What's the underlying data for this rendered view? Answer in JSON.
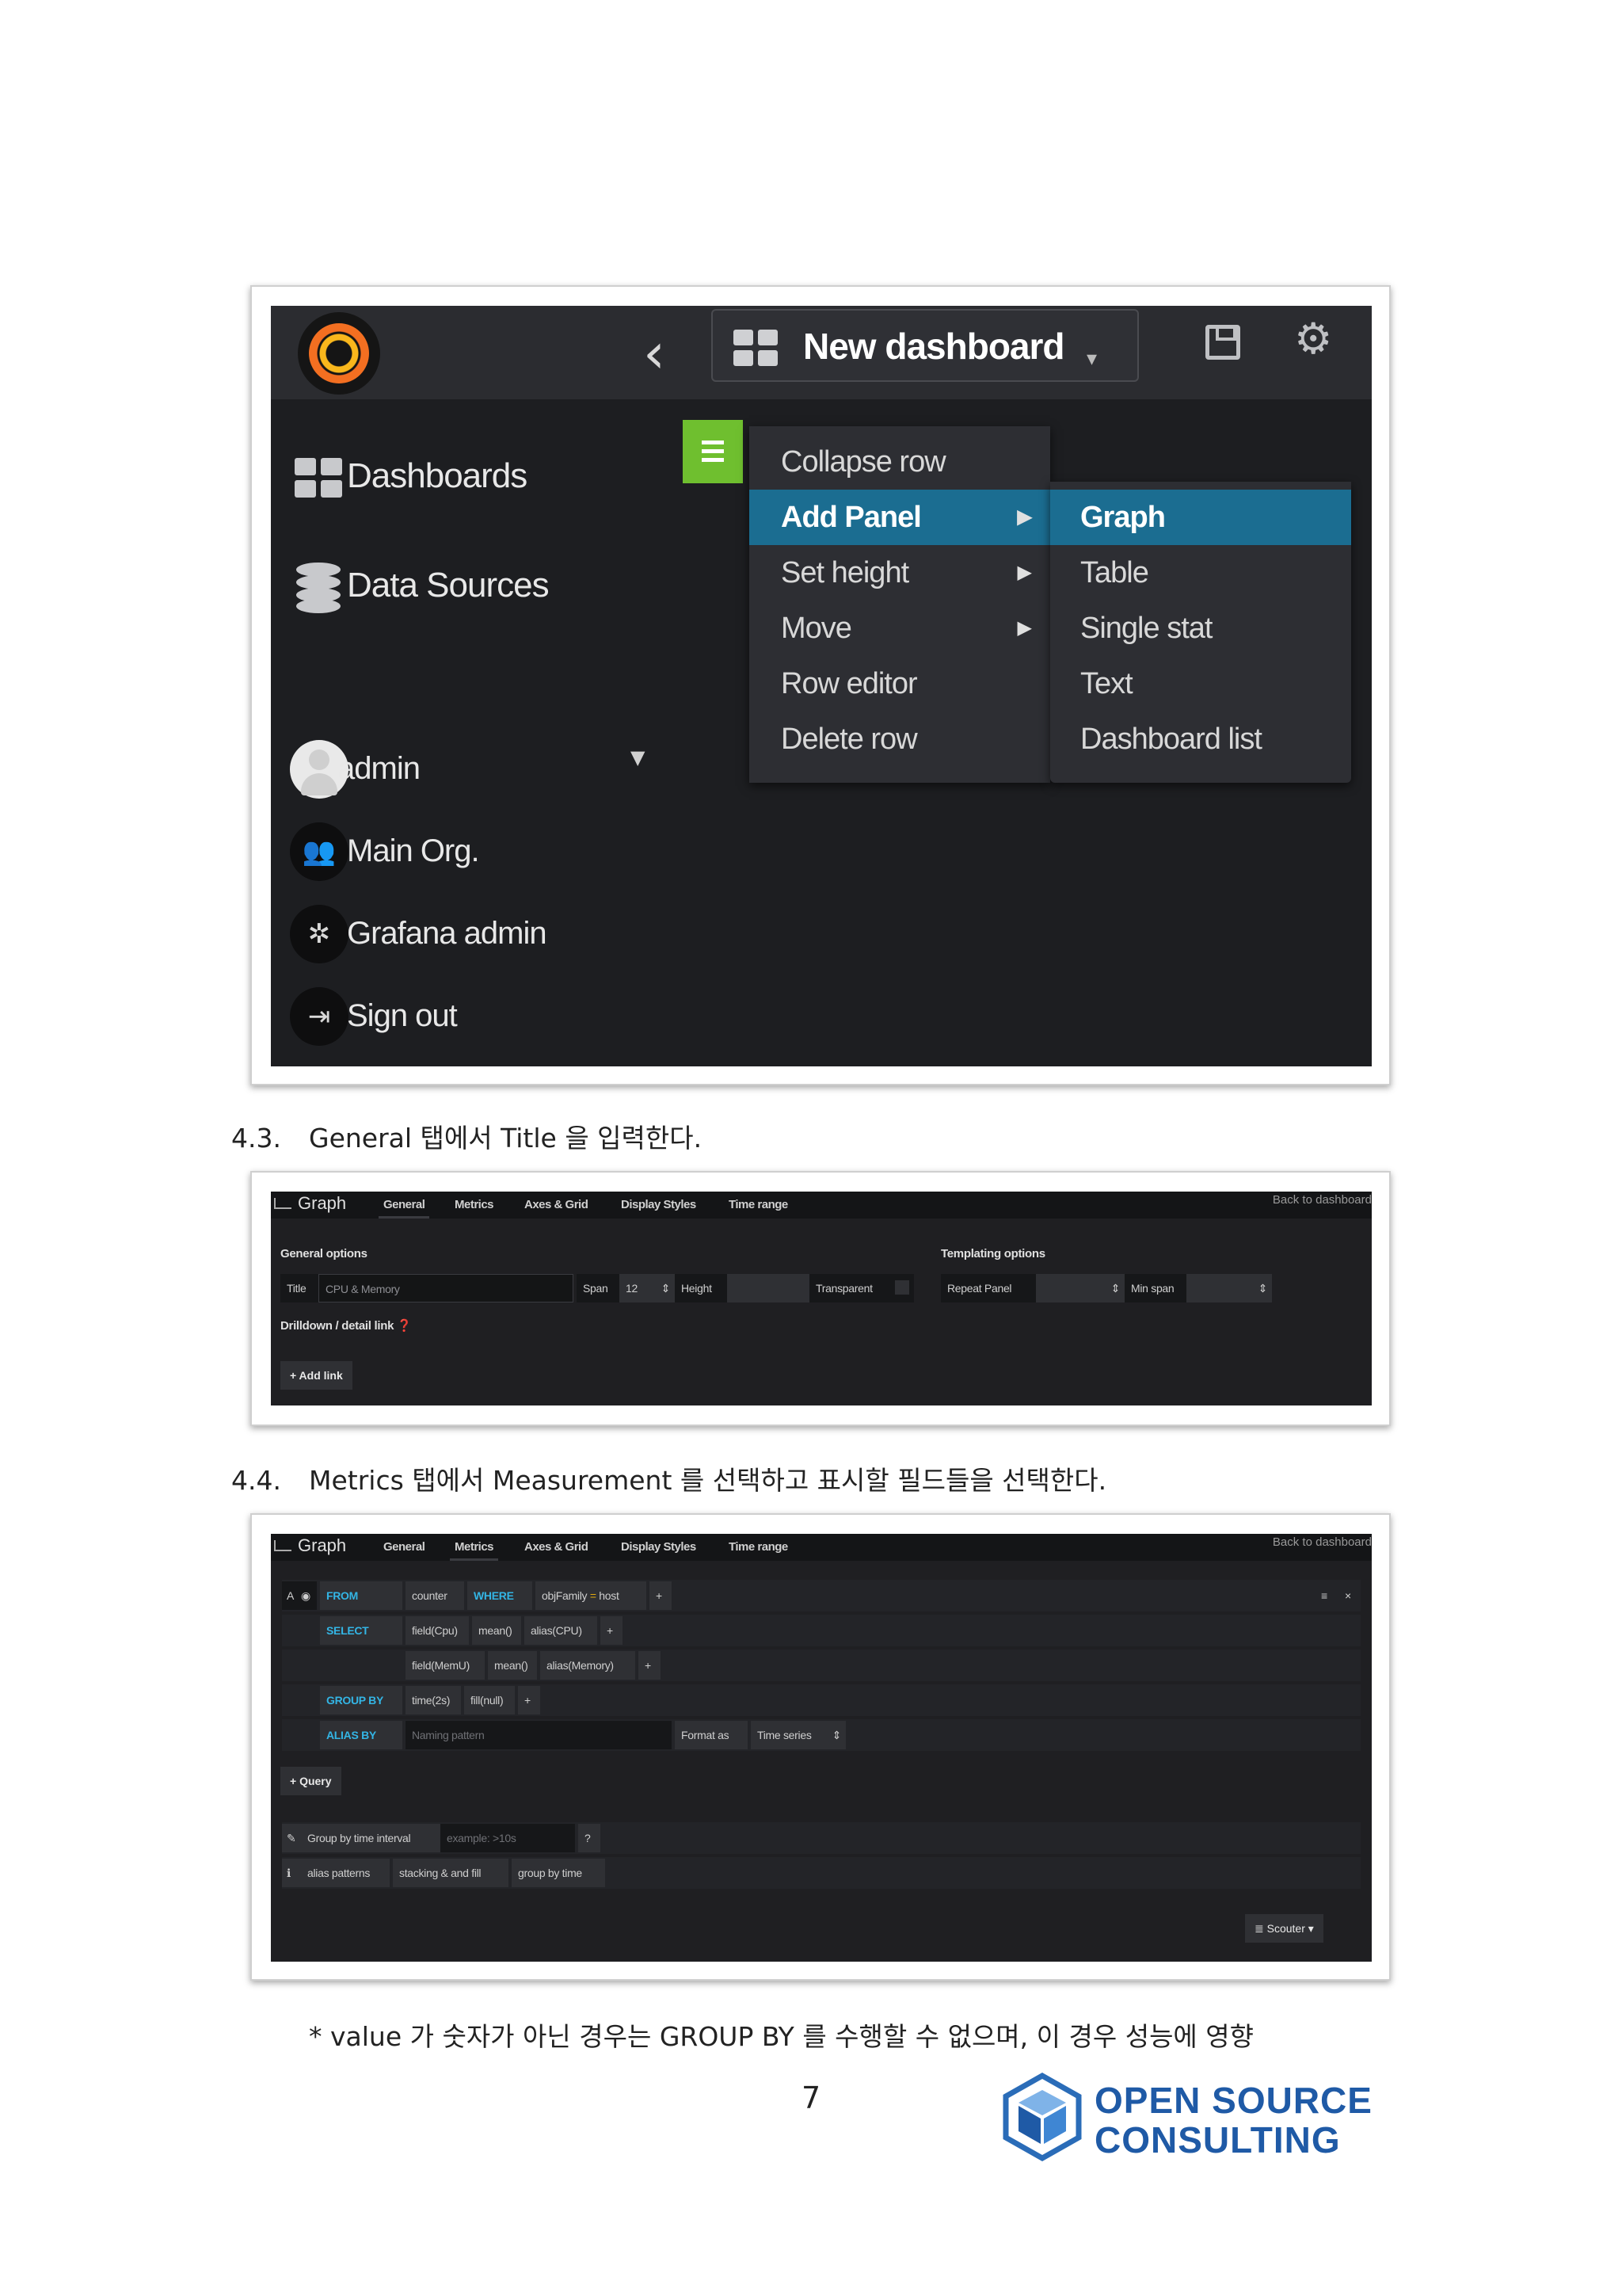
{
  "shot1": {
    "dashboard_title": "New dashboard",
    "sidebar": {
      "dashboards": "Dashboards",
      "data_sources": "Data Sources",
      "user": "admin",
      "org": "Main Org.",
      "grafana_admin": "Grafana admin",
      "sign_out": "Sign out"
    },
    "row_menu": [
      "Collapse row",
      "Add Panel",
      "Set height",
      "Move",
      "Row editor",
      "Delete row"
    ],
    "panel_menu": [
      "Graph",
      "Table",
      "Single stat",
      "Text",
      "Dashboard list"
    ]
  },
  "step_4_3": {
    "number": "4.3.",
    "text": "General 탭에서 Title 을 입력한다."
  },
  "step_4_4": {
    "number": "4.4.",
    "text": "Metrics 탭에서 Measurement 를 선택하고 표시할 필드들을 선택한다."
  },
  "editor_tabs": {
    "title": "Graph",
    "tabs": [
      "General",
      "Metrics",
      "Axes & Grid",
      "Display Styles",
      "Time range"
    ],
    "back": "Back to dashboard"
  },
  "shot2": {
    "general_options": "General options",
    "title_label": "Title",
    "title_value": "CPU & Memory",
    "span_label": "Span",
    "span_value": "12",
    "height_label": "Height",
    "transparent_label": "Transparent",
    "templating_options": "Templating options",
    "repeat_panel": "Repeat Panel",
    "min_span": "Min span",
    "drilldown": "Drilldown / detail link",
    "add_link": "+ Add link"
  },
  "shot3": {
    "query_letter": "A",
    "from": "FROM",
    "measurement": "counter",
    "where": "WHERE",
    "where_key": "objFamily",
    "where_op": "=",
    "where_val": "host",
    "select": "SELECT",
    "select_rows": [
      [
        "field(Cpu)",
        "mean()",
        "alias(CPU)"
      ],
      [
        "field(MemU)",
        "mean()",
        "alias(Memory)"
      ]
    ],
    "group_by": "GROUP BY",
    "group_items": [
      "time(2s)",
      "fill(null)"
    ],
    "alias_by": "ALIAS BY",
    "naming_pattern": "Naming pattern",
    "format_as": "Format as",
    "time_series": "Time series",
    "add_query": "+ Query",
    "group_interval_label": "Group by time interval",
    "group_interval_placeholder": "example: >10s",
    "help_items": [
      "alias patterns",
      "stacking & and fill",
      "group by time"
    ],
    "datasource": "Scouter"
  },
  "note": "* value 가 숫자가 아닌 경우는 GROUP BY 를 수행할 수 없으며, 이 경우 성능에 영향",
  "page_number": "7",
  "logo": {
    "line1": "OPEN SOURCE",
    "line2": "CONSULTING"
  },
  "colors": {
    "accent_blue": "#1b6d91",
    "grafana_green": "#6fbf2f",
    "keyword_blue": "#33b5e5",
    "logo_blue": "#1f5aa6"
  }
}
